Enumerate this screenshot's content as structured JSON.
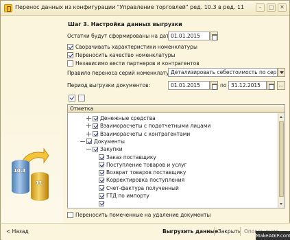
{
  "window": {
    "title": "Перенос данных из конфигурации \"Управление торговлей\" ред. 10.3 в ред. 11",
    "buttons": [
      "–",
      "□",
      "✕"
    ]
  },
  "graphic": {
    "blue_label": "10.3",
    "gold_label": "11"
  },
  "step": {
    "title": "Шаг 3. Настройка данных выгрузки"
  },
  "form": {
    "balances_label": "Остатки будут сформированы на дату:",
    "balances_date": "01.01.2015",
    "checkbox_chars": {
      "label": "Сворачивать характеристики номенклатуры",
      "checked": true
    },
    "checkbox_quality": {
      "label": "Переносить качество номенклатуры",
      "checked": true
    },
    "checkbox_independent": {
      "label": "Независимо вести партнеров и контрагентов",
      "checked": false
    },
    "series_rule_label": "Правило переноса серий номенклатуры:",
    "series_rule_value": "Детализировать себестоимость по сериям",
    "period_label": "Период выгрузки документов:",
    "period_from": "01.01.2015",
    "period_to_label": "по",
    "period_to": "31.12.2015",
    "more_button": "...",
    "bottom_checkbox": {
      "label": "Переносить помеченные на удаление документы",
      "checked": false
    }
  },
  "tree": {
    "column_header": "Отметка",
    "rows": [
      {
        "label": "Денежные средства",
        "level": 1,
        "expander": "plus",
        "checked": true
      },
      {
        "label": "Взаиморасчеты с подотчетными лицами",
        "level": 1,
        "expander": "plus",
        "checked": true
      },
      {
        "label": "Взаиморасчеты с контрагентами",
        "level": 1,
        "expander": "plus",
        "checked": true
      },
      {
        "label": "Документы",
        "level": 0,
        "expander": "minus",
        "checked": true
      },
      {
        "label": "Закупки",
        "level": 1,
        "expander": "minus",
        "checked": true
      },
      {
        "label": "Заказ поставщику",
        "level": 2,
        "expander": "none",
        "checked": true
      },
      {
        "label": "Поступление товаров и услуг",
        "level": 2,
        "expander": "none",
        "checked": true
      },
      {
        "label": "Возврат товаров поставщику",
        "level": 2,
        "expander": "none",
        "checked": true
      },
      {
        "label": "Корректировка поступления",
        "level": 2,
        "expander": "none",
        "checked": true
      },
      {
        "label": "Счет-фактура полученный",
        "level": 2,
        "expander": "none",
        "checked": true
      },
      {
        "label": "ГТД по импорту",
        "level": 2,
        "expander": "none",
        "checked": true
      },
      {
        "label": "",
        "level": 2,
        "expander": "none",
        "checked": true
      }
    ]
  },
  "bottom": {
    "back": "< Назад",
    "export": "Выгрузить данные",
    "close": "Закрыть",
    "help": "Оповещение"
  },
  "watermark": "MakeAGIF.com"
}
